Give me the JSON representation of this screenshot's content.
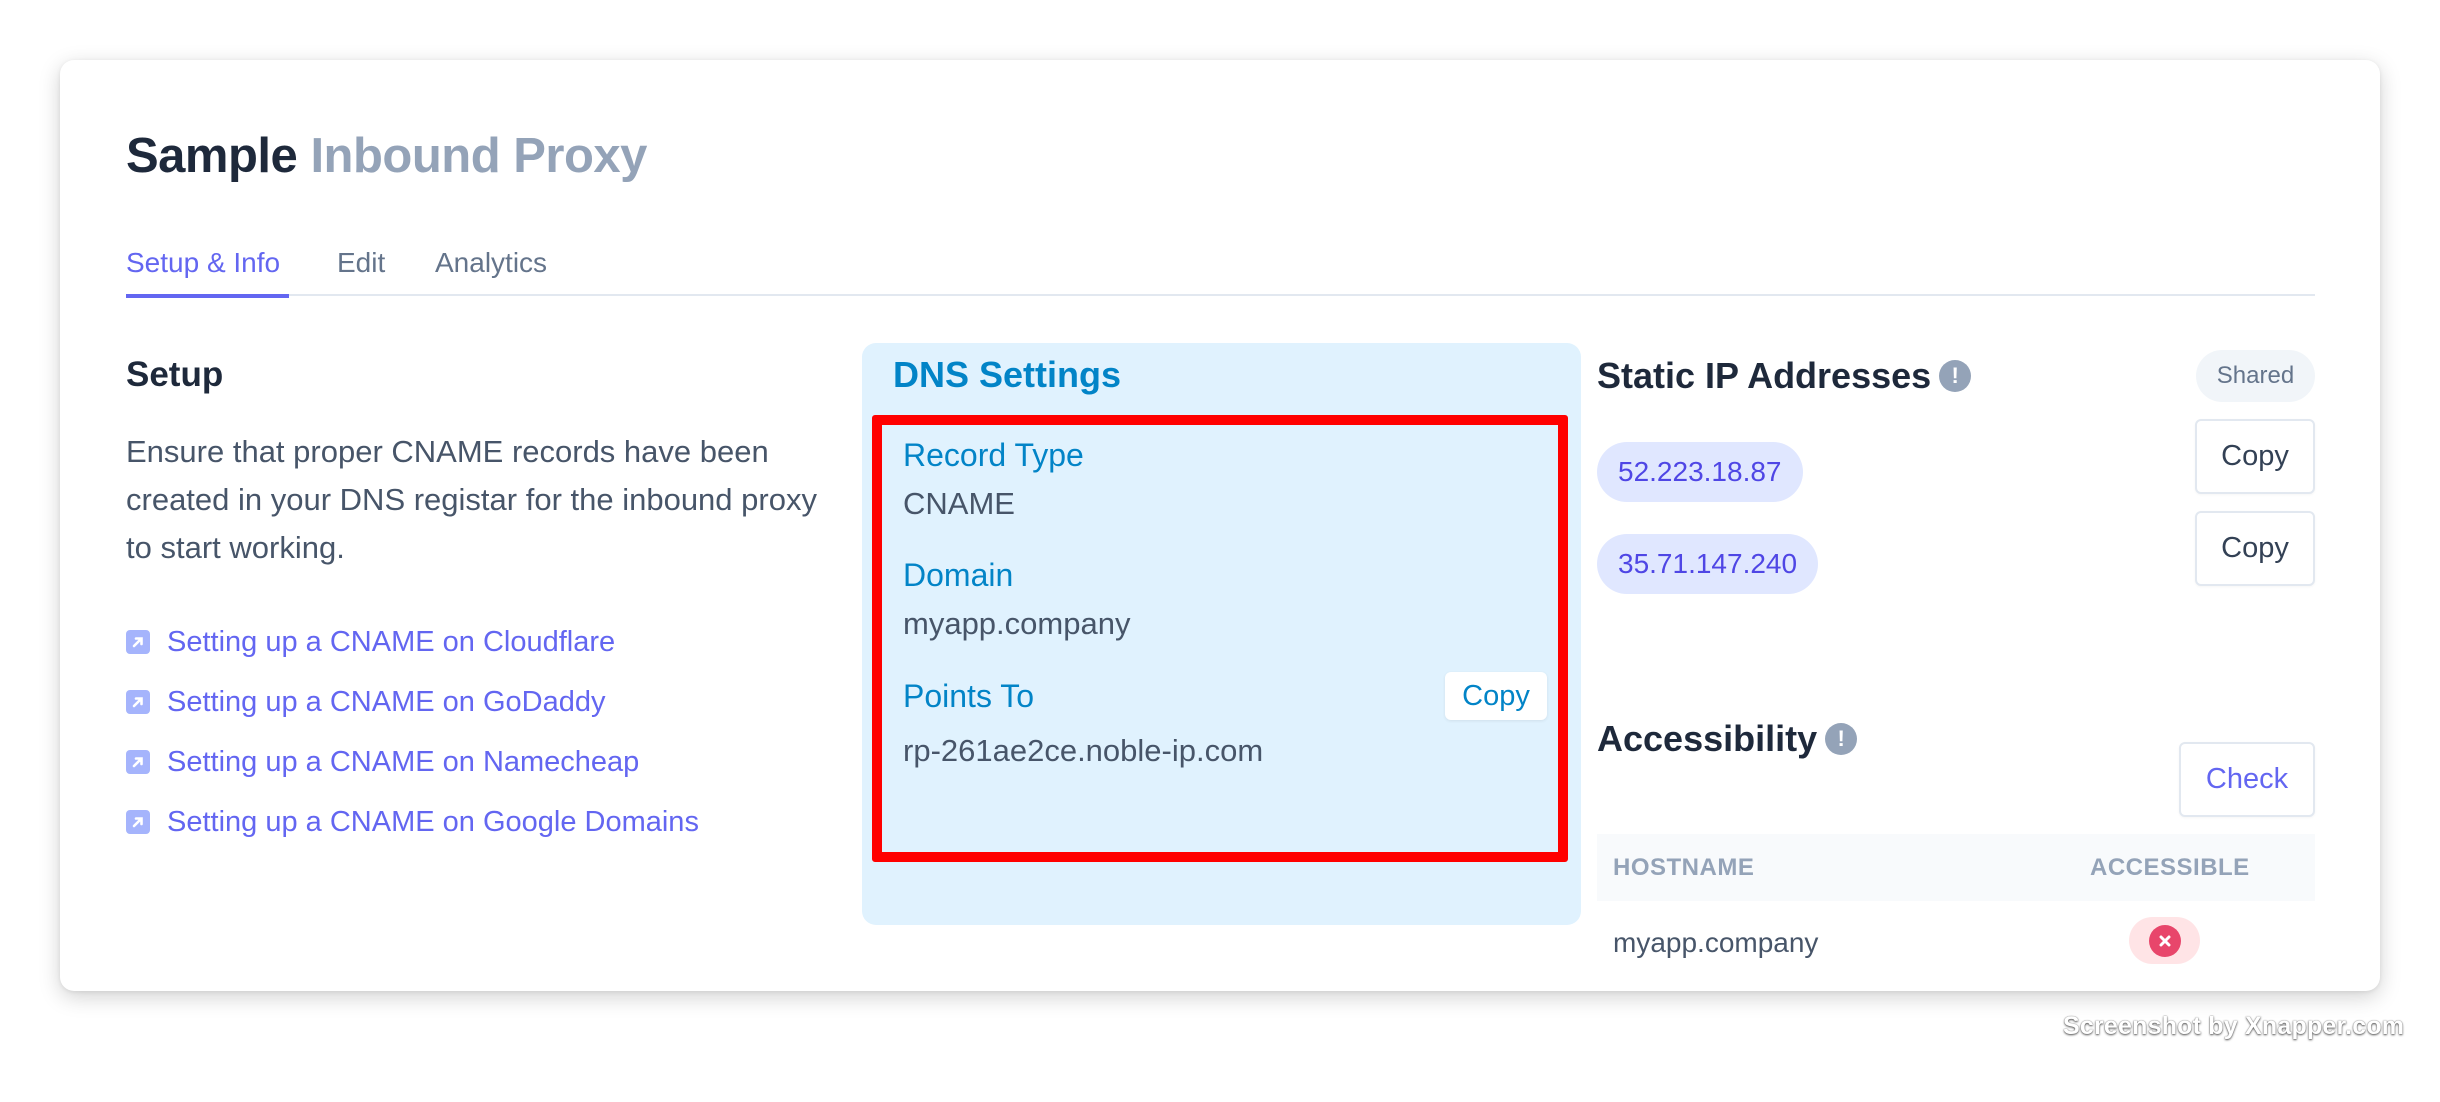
{
  "header": {
    "title_primary": "Sample",
    "title_secondary": "Inbound Proxy"
  },
  "tabs": [
    {
      "label": "Setup & Info",
      "active": true
    },
    {
      "label": "Edit",
      "active": false
    },
    {
      "label": "Analytics",
      "active": false
    }
  ],
  "setup": {
    "heading": "Setup",
    "description": "Ensure that proper CNAME records have been created in your DNS registar for the inbound proxy to start working.",
    "links": [
      {
        "label": "Setting up a CNAME on Cloudflare",
        "icon": "external-link-icon"
      },
      {
        "label": "Setting up a CNAME on GoDaddy",
        "icon": "external-link-icon"
      },
      {
        "label": "Setting up a CNAME on Namecheap",
        "icon": "external-link-icon"
      },
      {
        "label": "Setting up a CNAME on Google Domains",
        "icon": "external-link-icon"
      }
    ]
  },
  "dns": {
    "title": "DNS Settings",
    "fields": [
      {
        "label": "Record Type",
        "value": "CNAME"
      },
      {
        "label": "Domain",
        "value": "myapp.company"
      },
      {
        "label": "Points To",
        "value": "rp-261ae2ce.noble-ip.com"
      }
    ],
    "copy_label": "Copy",
    "highlight_color": "#ff0000"
  },
  "static_ips": {
    "heading": "Static IP Addresses",
    "info_icon": "info-icon",
    "badge": "Shared",
    "addresses": [
      {
        "ip": "52.223.18.87",
        "copy_label": "Copy"
      },
      {
        "ip": "35.71.147.240",
        "copy_label": "Copy"
      }
    ]
  },
  "accessibility": {
    "heading": "Accessibility",
    "info_icon": "info-icon",
    "check_label": "Check",
    "columns": [
      "HOSTNAME",
      "ACCESSIBLE"
    ],
    "rows": [
      {
        "hostname": "myapp.company",
        "accessible": false,
        "status_icon": "x-circle-icon"
      }
    ]
  },
  "colors": {
    "accent": "#6366f1",
    "dns_accent": "#0284c7",
    "dns_bg": "#e0f2fe",
    "ip_pill_bg": "#e0e7ff",
    "ip_pill_text": "#4f46e5",
    "error": "#e8466b"
  },
  "watermark": "Screenshot by Xnapper.com"
}
